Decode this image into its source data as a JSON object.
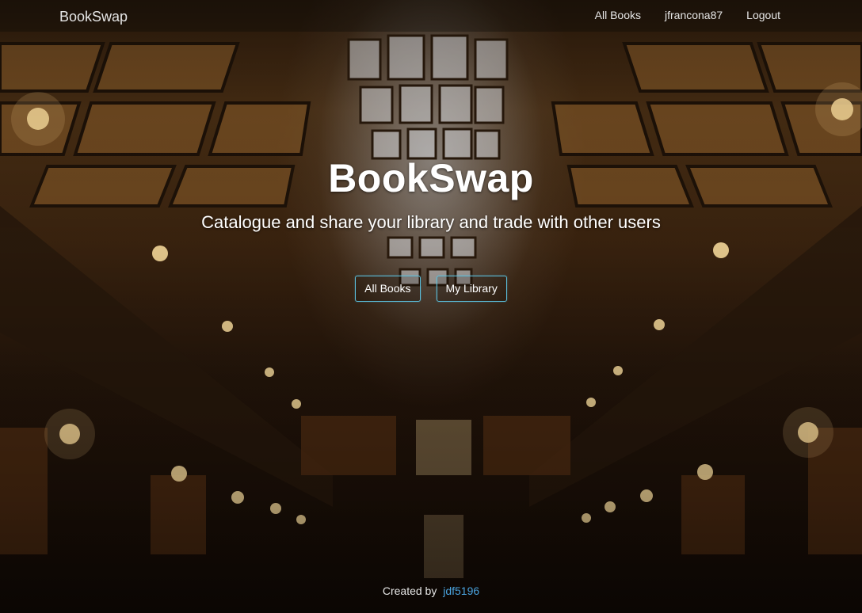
{
  "navbar": {
    "brand": "BookSwap",
    "links": [
      {
        "label": "All Books"
      },
      {
        "label": "jfrancona87"
      },
      {
        "label": "Logout"
      }
    ]
  },
  "hero": {
    "title": "BookSwap",
    "subtitle": "Catalogue and share your library and trade with other users",
    "buttons": [
      {
        "label": "All Books"
      },
      {
        "label": "My Library"
      }
    ],
    "button_border_color": "#5bc0de"
  },
  "footer": {
    "prefix": "Created by",
    "author_link": "jdf5196",
    "link_color": "#4aa3df"
  },
  "background": {
    "description_icon": "library-hall-photo"
  }
}
